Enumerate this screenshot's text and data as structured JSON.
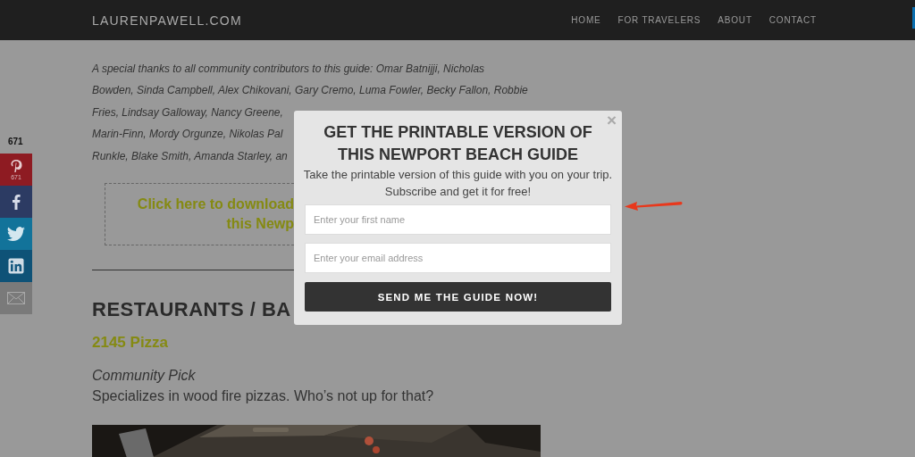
{
  "header": {
    "logo": "LAURENPAWELL.COM",
    "nav": [
      {
        "label": "HOME"
      },
      {
        "label": "FOR TRAVELERS"
      },
      {
        "label": "ABOUT"
      },
      {
        "label": "CONTACT"
      }
    ]
  },
  "share": {
    "count": "671",
    "buttons": [
      {
        "kind": "pinterest",
        "count": "671"
      },
      {
        "kind": "facebook"
      },
      {
        "kind": "twitter"
      },
      {
        "kind": "linkedin"
      },
      {
        "kind": "email"
      }
    ]
  },
  "article": {
    "thanks_lines": [
      "A special thanks to all community contributors to this guide: Omar Batnijji, Nicholas",
      "Bowden, Sinda Campbell, Alex Chikovani, Gary Cremo, Luma Fowler, Becky Fallon, Robbie",
      "Fries, Lindsay Galloway, Nancy Greene,",
      "Marin-Finn, Mordy Orgunze, Nikolas Pal",
      "Runkle, Blake Smith, Amanda Starley, an"
    ],
    "download_lines": [
      "Click here to download",
      "this Newp"
    ],
    "heading": "RESTAURANTS / BA",
    "place": "2145 Pizza",
    "pick": "Community Pick",
    "description": "Specializes in wood fire pizzas. Who’s not up for that?"
  },
  "popup": {
    "close": "×",
    "title_lines": [
      "GET THE PRINTABLE VERSION OF",
      "THIS NEWPORT BEACH GUIDE"
    ],
    "text_lines": [
      "Take the printable version of this guide with you on your trip.",
      "Subscribe and get it for free!"
    ],
    "fields": [
      {
        "placeholder": "Enter your first name"
      },
      {
        "placeholder": "Enter your email address"
      }
    ],
    "button": "SEND ME THE GUIDE NOW!"
  }
}
